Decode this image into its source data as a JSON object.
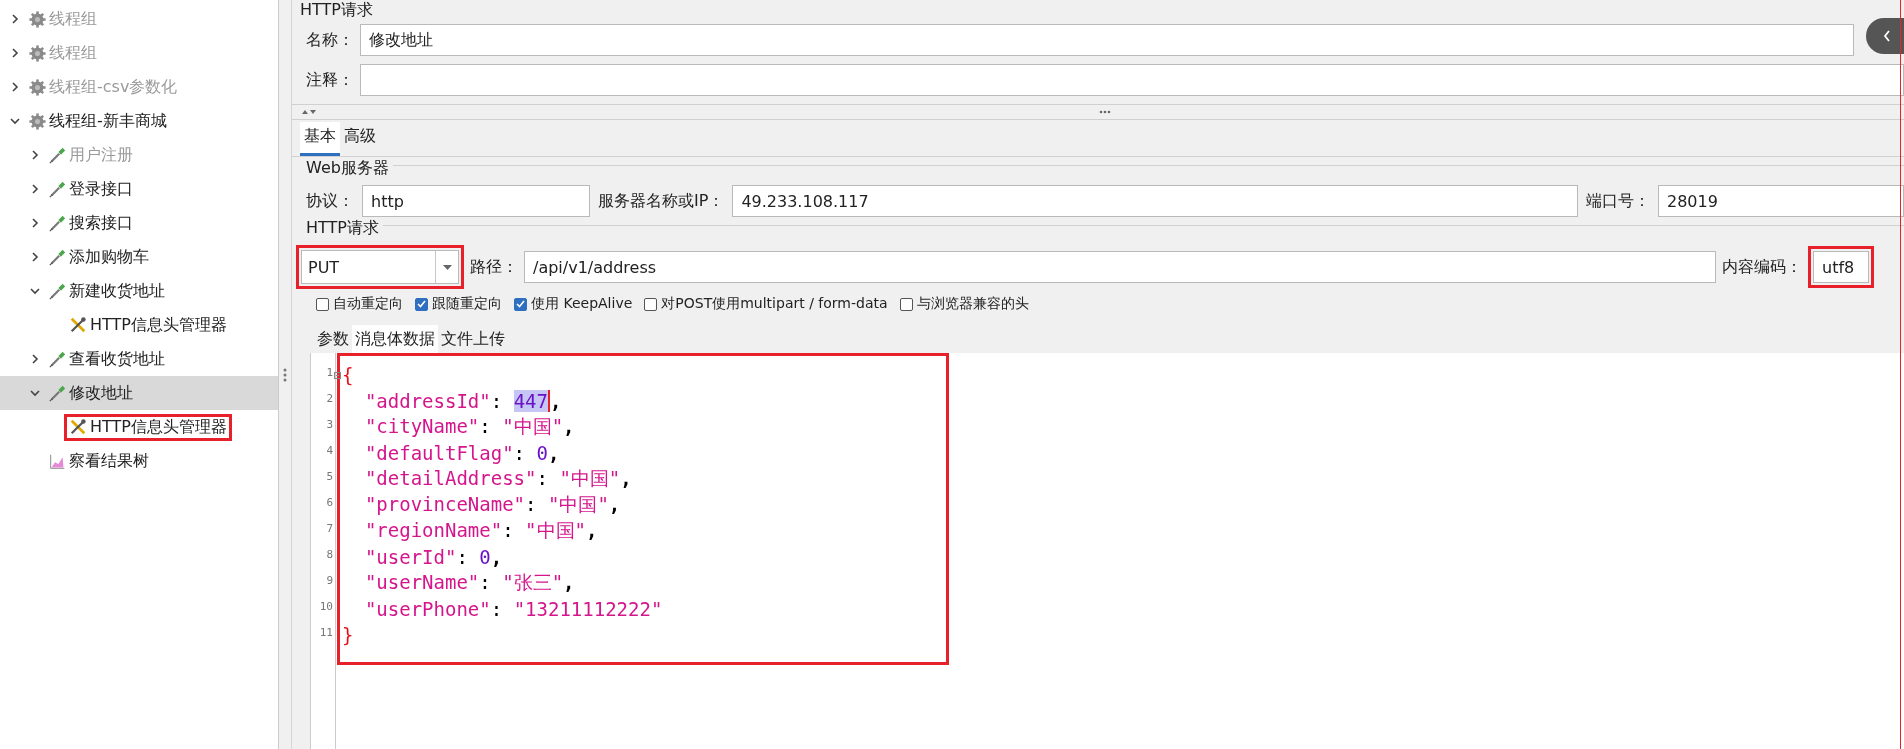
{
  "tree": [
    {
      "label": "线程组",
      "kind": "thread-group",
      "expanded": false,
      "disabled": true,
      "selected": false,
      "highlighted": false
    },
    {
      "label": "线程组",
      "kind": "thread-group",
      "expanded": false,
      "disabled": true,
      "selected": false,
      "highlighted": false
    },
    {
      "label": "线程组-csv参数化",
      "kind": "thread-group",
      "expanded": false,
      "disabled": true,
      "selected": false,
      "highlighted": false
    },
    {
      "label": "线程组-新丰商城",
      "kind": "thread-group",
      "expanded": true,
      "disabled": false,
      "selected": false,
      "highlighted": false,
      "children": [
        {
          "label": "用户注册",
          "kind": "sampler",
          "expanded": false,
          "disabled": true,
          "selected": false,
          "highlighted": false
        },
        {
          "label": "登录接口",
          "kind": "sampler",
          "expanded": false,
          "disabled": false,
          "selected": false,
          "highlighted": false
        },
        {
          "label": "搜索接口",
          "kind": "sampler",
          "expanded": false,
          "disabled": false,
          "selected": false,
          "highlighted": false
        },
        {
          "label": "添加购物车",
          "kind": "sampler",
          "expanded": false,
          "disabled": false,
          "selected": false,
          "highlighted": false
        },
        {
          "label": "新建收货地址",
          "kind": "sampler",
          "expanded": true,
          "disabled": false,
          "selected": false,
          "highlighted": false,
          "children": [
            {
              "label": "HTTP信息头管理器",
              "kind": "config",
              "disabled": false,
              "selected": false,
              "highlighted": false
            }
          ]
        },
        {
          "label": "查看收货地址",
          "kind": "sampler",
          "expanded": false,
          "disabled": false,
          "selected": false,
          "highlighted": false
        },
        {
          "label": "修改地址",
          "kind": "sampler",
          "expanded": true,
          "disabled": false,
          "selected": true,
          "highlighted": false,
          "children": [
            {
              "label": "HTTP信息头管理器",
              "kind": "config",
              "disabled": false,
              "selected": false,
              "highlighted": true
            }
          ]
        },
        {
          "label": "察看结果树",
          "kind": "listener",
          "disabled": false,
          "selected": false,
          "highlighted": false
        }
      ]
    }
  ],
  "panel": {
    "title": "HTTP请求",
    "name": {
      "label": "名称：",
      "value": "修改地址"
    },
    "comment": {
      "label": "注释："
    },
    "tabs": [
      {
        "label": "基本",
        "selected": true
      },
      {
        "label": "高级",
        "selected": false
      }
    ],
    "web_server": {
      "legend": "Web服务器",
      "protocol_label": "协议：",
      "protocol": "http",
      "server_label": "服务器名称或IP：",
      "server": "49.233.108.117",
      "port_label": "端口号：",
      "port": "28019"
    },
    "http_request": {
      "legend": "HTTP请求",
      "method": "PUT",
      "method_highlighted": true,
      "path_label": "路径：",
      "path": "/api/v1/address",
      "encoding_label": "内容编码：",
      "encoding": "utf8",
      "encoding_highlighted": true
    },
    "options": [
      {
        "label": "自动重定向",
        "checked": false
      },
      {
        "label": "跟随重定向",
        "checked": true
      },
      {
        "label": "使用 KeepAlive",
        "checked": true
      },
      {
        "label": "对POST使用multipart / form-data",
        "checked": false
      },
      {
        "label": "与浏览器兼容的头",
        "checked": false
      }
    ],
    "body_tabs": [
      {
        "label": "参数",
        "selected": false
      },
      {
        "label": "消息体数据",
        "selected": true
      },
      {
        "label": "文件上传",
        "selected": false
      }
    ],
    "editor": {
      "highlighted": true,
      "lines": [
        {
          "number": "1",
          "text": "{",
          "foldable": true
        },
        {
          "number": "2",
          "text": "  \"addressId\": ",
          "selection": "447",
          "after": ","
        },
        {
          "number": "3",
          "text": "  \"cityName\": \"中国\","
        },
        {
          "number": "4",
          "text": "  \"defaultFlag\": 0,"
        },
        {
          "number": "5",
          "text": "  \"detailAddress\": \"中国\","
        },
        {
          "number": "6",
          "text": "  \"provinceName\": \"中国\","
        },
        {
          "number": "7",
          "text": "  \"regionName\": \"中国\","
        },
        {
          "number": "8",
          "text": "  \"userId\": 0,"
        },
        {
          "number": "9",
          "text": "  \"userName\": \"张三\","
        },
        {
          "number": "10",
          "text": "  \"userPhone\": \"13211112222\""
        },
        {
          "number": "11",
          "text": "}"
        }
      ]
    }
  }
}
